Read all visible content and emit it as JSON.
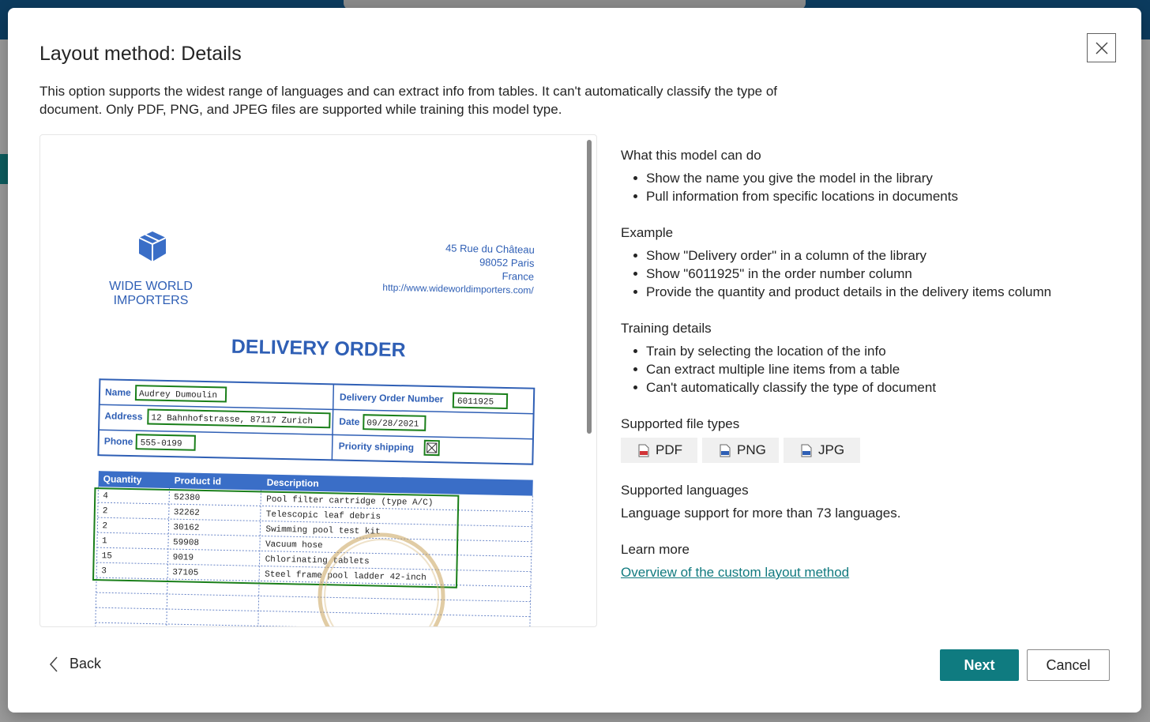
{
  "dialog": {
    "title": "Layout method: Details",
    "description": "This option supports the widest range of languages and can extract info from tables. It can't automatically classify the type of document. Only PDF, PNG, and JPEG files are supported while training this model type."
  },
  "preview": {
    "company_name_line1": "WIDE WORLD",
    "company_name_line2": "IMPORTERS",
    "address_line1": "45 Rue du Château",
    "address_line2": "98052 Paris",
    "address_line3": "France",
    "address_line4": "http://www.wideworldimporters.com/",
    "doc_title": "DELIVERY ORDER",
    "fields": {
      "name_label": "Name",
      "name_value": "Audrey Dumoulin",
      "address_label": "Address",
      "address_value": "12 Bahnhofstrasse, 87117 Zurich",
      "phone_label": "Phone",
      "phone_value": "555-0199",
      "order_number_label": "Delivery Order Number",
      "order_number_value": "6011925",
      "date_label": "Date",
      "date_value": "09/28/2021",
      "priority_label": "Priority shipping"
    },
    "table": {
      "headers": [
        "Quantity",
        "Product id",
        "Description"
      ],
      "rows": [
        [
          "4",
          "52380",
          "Pool filter cartridge (type A/C)"
        ],
        [
          "2",
          "32262",
          "Telescopic leaf debris"
        ],
        [
          "2",
          "30162",
          "Swimming pool test kit"
        ],
        [
          "1",
          "59908",
          "Vacuum hose"
        ],
        [
          "15",
          "9019",
          "Chlorinating tablets"
        ],
        [
          "3",
          "37105",
          "Steel frame pool ladder 42-inch"
        ]
      ]
    }
  },
  "info": {
    "can_do": {
      "heading": "What this model can do",
      "items": [
        "Show the name you give the model in the library",
        "Pull information from specific locations in documents"
      ]
    },
    "example": {
      "heading": "Example",
      "items": [
        "Show \"Delivery order\" in a column of the library",
        "Show \"6011925\" in the order number column",
        "Provide the quantity and product details in the delivery items column"
      ]
    },
    "training": {
      "heading": "Training details",
      "items": [
        "Train by selecting the location of the info",
        "Can extract multiple line items from a table",
        "Can't automatically classify the type of document"
      ]
    },
    "file_types": {
      "heading": "Supported file types",
      "items": [
        "PDF",
        "PNG",
        "JPG"
      ]
    },
    "languages": {
      "heading": "Supported languages",
      "text": "Language support for more than 73 languages."
    },
    "learn_more": {
      "heading": "Learn more",
      "link": "Overview of the custom layout method"
    }
  },
  "footer": {
    "back_label": "Back",
    "next_label": "Next",
    "cancel_label": "Cancel"
  },
  "colors": {
    "accent": "#0f7b80",
    "doc_blue": "#2f5fb5",
    "highlight_green": "#1a7f1a"
  },
  "icons": [
    "close-icon",
    "chevron-left-icon",
    "pdf-file-icon",
    "png-file-icon",
    "jpg-file-icon",
    "box-logo-icon"
  ]
}
